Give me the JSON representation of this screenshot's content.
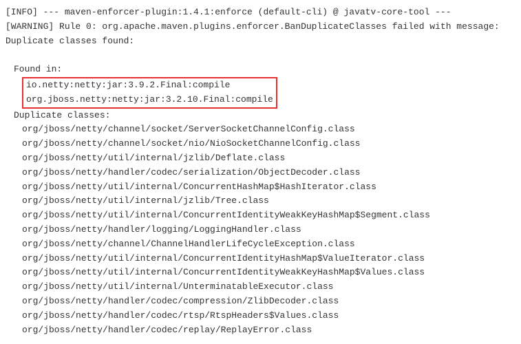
{
  "log": {
    "info_line": "[INFO] --- maven-enforcer-plugin:1.4.1:enforce (default-cli) @ javatv-core-tool ---",
    "warning_line": "[WARNING] Rule 0: org.apache.maven.plugins.enforcer.BanDuplicateClasses failed with message:",
    "duplicates_header": "Duplicate classes found:",
    "found_in_label": "Found in:",
    "found_in": [
      "io.netty:netty:jar:3.9.2.Final:compile",
      "org.jboss.netty:netty:jar:3.2.10.Final:compile"
    ],
    "duplicate_classes_label": "Duplicate classes:",
    "duplicate_classes": [
      "org/jboss/netty/channel/socket/ServerSocketChannelConfig.class",
      "org/jboss/netty/channel/socket/nio/NioSocketChannelConfig.class",
      "org/jboss/netty/util/internal/jzlib/Deflate.class",
      "org/jboss/netty/handler/codec/serialization/ObjectDecoder.class",
      "org/jboss/netty/util/internal/ConcurrentHashMap$HashIterator.class",
      "org/jboss/netty/util/internal/jzlib/Tree.class",
      "org/jboss/netty/util/internal/ConcurrentIdentityWeakKeyHashMap$Segment.class",
      "org/jboss/netty/handler/logging/LoggingHandler.class",
      "org/jboss/netty/channel/ChannelHandlerLifeCycleException.class",
      "org/jboss/netty/util/internal/ConcurrentIdentityHashMap$ValueIterator.class",
      "org/jboss/netty/util/internal/ConcurrentIdentityWeakKeyHashMap$Values.class",
      "org/jboss/netty/util/internal/UnterminatableExecutor.class",
      "org/jboss/netty/handler/codec/compression/ZlibDecoder.class",
      "org/jboss/netty/handler/codec/rtsp/RtspHeaders$Values.class",
      "org/jboss/netty/handler/codec/replay/ReplayError.class"
    ]
  }
}
